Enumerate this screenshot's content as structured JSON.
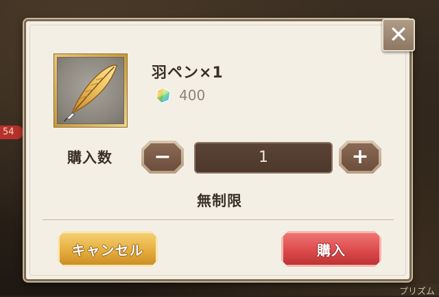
{
  "background": {
    "badge": "54",
    "fragment": "プリズム"
  },
  "dialog": {
    "close_icon": "✕",
    "item": {
      "icon": "quill-pen-icon",
      "name": "羽ペン×1",
      "price_icon": "prism-gem-icon",
      "price": "400"
    },
    "quantity": {
      "label": "購入数",
      "minus": "−",
      "value": "1",
      "plus": "+"
    },
    "limit_text": "無制限",
    "cancel_label": "キャンセル",
    "buy_label": "購入"
  },
  "colors": {
    "cancel": "#e6ad3c",
    "buy": "#dd4a4c",
    "panel": "#f4efe4",
    "qty_field": "#4d382c"
  }
}
